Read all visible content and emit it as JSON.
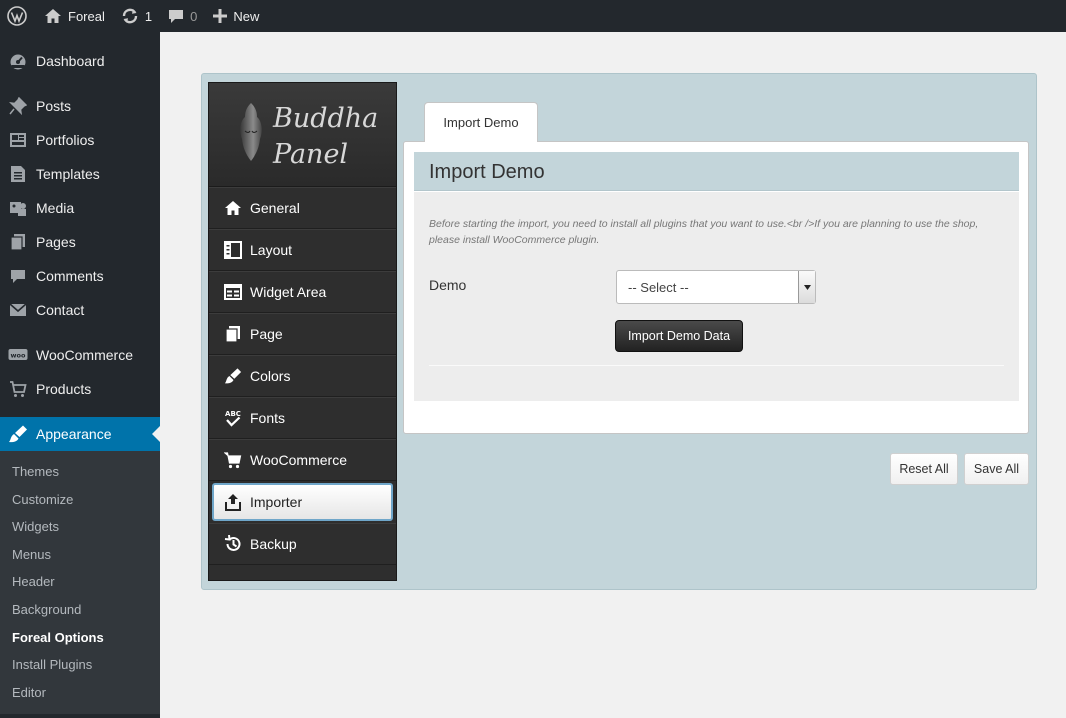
{
  "adminbar": {
    "site_name": "Foreal",
    "updates_count": "1",
    "comments_count": "0",
    "new_label": "New"
  },
  "sidebar": {
    "items": [
      {
        "label": "Dashboard",
        "icon": "dashboard-icon"
      },
      {
        "label": "Posts",
        "icon": "pin-icon"
      },
      {
        "label": "Portfolios",
        "icon": "portfolio-icon"
      },
      {
        "label": "Templates",
        "icon": "document-icon"
      },
      {
        "label": "Media",
        "icon": "media-icon"
      },
      {
        "label": "Pages",
        "icon": "pages-icon"
      },
      {
        "label": "Comments",
        "icon": "comment-icon"
      },
      {
        "label": "Contact",
        "icon": "mail-icon"
      },
      {
        "label": "WooCommerce",
        "icon": "woo-icon"
      },
      {
        "label": "Products",
        "icon": "cart-icon"
      },
      {
        "label": "Appearance",
        "icon": "brush-icon"
      }
    ],
    "submenu": [
      "Themes",
      "Customize",
      "Widgets",
      "Menus",
      "Header",
      "Background",
      "Foreal Options",
      "Install Plugins",
      "Editor"
    ],
    "active_item": "Appearance",
    "current_submenu": "Foreal Options"
  },
  "panel": {
    "logo": {
      "line1": "Buddha",
      "line2": "Panel"
    },
    "nav": [
      {
        "label": "General",
        "icon": "home-icon"
      },
      {
        "label": "Layout",
        "icon": "layout-icon"
      },
      {
        "label": "Widget Area",
        "icon": "widget-icon"
      },
      {
        "label": "Page",
        "icon": "page-icon"
      },
      {
        "label": "Colors",
        "icon": "brush-icon"
      },
      {
        "label": "Fonts",
        "icon": "abc-check-icon"
      },
      {
        "label": "WooCommerce",
        "icon": "cart-icon"
      },
      {
        "label": "Importer",
        "icon": "upload-icon"
      },
      {
        "label": "Backup",
        "icon": "history-icon"
      }
    ],
    "selected_nav": "Importer",
    "tab_label": "Import Demo",
    "section_title": "Import Demo",
    "description": "Before starting the import, you need to install all plugins that you want to use.<br />If you are planning to use the shop, please install WooCommerce plugin.",
    "demo_label": "Demo",
    "demo_select_value": "-- Select --",
    "import_button": "Import Demo Data",
    "reset_button": "Reset All",
    "save_button": "Save All"
  }
}
